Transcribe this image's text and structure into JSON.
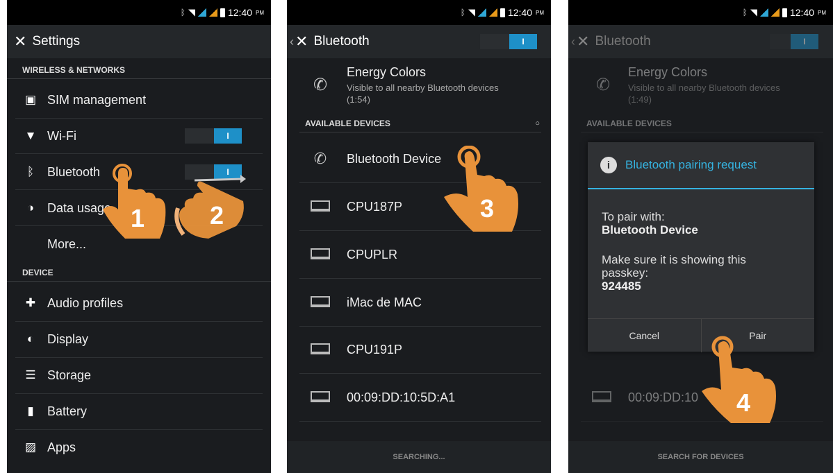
{
  "status": {
    "time": "12:40",
    "ampm": "PM"
  },
  "screen1": {
    "title": "Settings",
    "section_wireless": "WIRELESS & NETWORKS",
    "items_wireless": [
      "SIM management",
      "Wi-Fi",
      "Bluetooth",
      "Data usage",
      "More..."
    ],
    "section_device": "DEVICE",
    "items_device": [
      "Audio profiles",
      "Display",
      "Storage",
      "Battery",
      "Apps"
    ],
    "toggle_on": "I",
    "steps": [
      "1",
      "2"
    ]
  },
  "screen2": {
    "title": "Bluetooth",
    "toggle_on": "I",
    "this_device": {
      "name": "Energy Colors",
      "visibility": "Visible to all nearby Bluetooth devices",
      "timer": "(1:54)"
    },
    "section_available": "AVAILABLE DEVICES",
    "devices": [
      "Bluetooth Device",
      "CPU187P",
      "CPUPLR",
      "iMac de MAC",
      "CPU191P",
      "00:09:DD:10:5D:A1"
    ],
    "bottom": "SEARCHING...",
    "step": "3"
  },
  "screen3": {
    "title": "Bluetooth",
    "toggle_on": "I",
    "this_device": {
      "name": "Energy Colors",
      "visibility": "Visible to all nearby Bluetooth devices",
      "timer": "(1:49)"
    },
    "section_available": "AVAILABLE DEVICES",
    "partial_device": "00:09:DD:10",
    "bottom": "SEARCH FOR DEVICES",
    "dialog": {
      "title": "Bluetooth pairing request",
      "pair_with_label": "To pair with:",
      "device": "Bluetooth Device",
      "instruction": "Make sure it is showing this passkey:",
      "passkey": "924485",
      "cancel": "Cancel",
      "pair": "Pair"
    },
    "step": "4"
  },
  "colors": {
    "accent": "#1e90c8",
    "dialog_accent": "#35b3e0",
    "hand": "#e8923a"
  }
}
